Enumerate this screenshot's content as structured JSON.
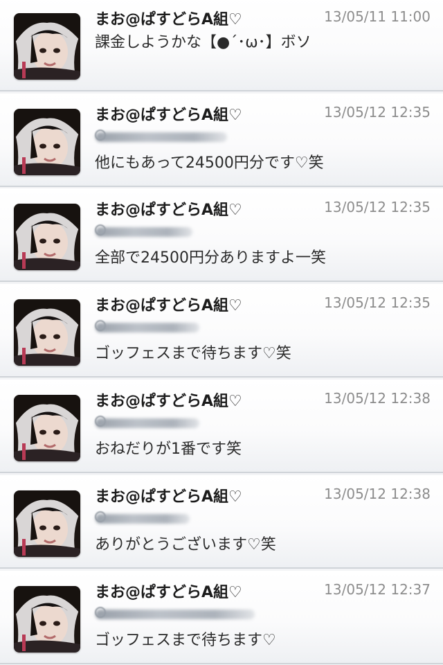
{
  "timeline": {
    "tweets": [
      {
        "author": "まお@ぱすどらA組♡",
        "timestamp": "13/05/11 11:00",
        "has_reply_mention": false,
        "text": "課金しようかな【●´･ω･】ボソ"
      },
      {
        "author": "まお@ぱすどらA組♡",
        "timestamp": "13/05/12 12:35",
        "has_reply_mention": true,
        "text": "他にもあって24500円分です♡笑"
      },
      {
        "author": "まお@ぱすどらA組♡",
        "timestamp": "13/05/12 12:35",
        "has_reply_mention": true,
        "text": "全部で24500円分ありますよ一笑"
      },
      {
        "author": "まお@ぱすどらA組♡",
        "timestamp": "13/05/12 12:35",
        "has_reply_mention": true,
        "text": "ゴッフェスまで待ちます♡笑"
      },
      {
        "author": "まお@ぱすどらA組♡",
        "timestamp": "13/05/12 12:38",
        "has_reply_mention": true,
        "text": "おねだりが1番です笑"
      },
      {
        "author": "まお@ぱすどらA組♡",
        "timestamp": "13/05/12 12:38",
        "has_reply_mention": true,
        "text": "ありがとうございます♡笑"
      },
      {
        "author": "まお@ぱすどらA組♡",
        "timestamp": "13/05/12 12:37",
        "has_reply_mention": true,
        "text": "ゴッフェスまで待ちます♡"
      }
    ]
  }
}
